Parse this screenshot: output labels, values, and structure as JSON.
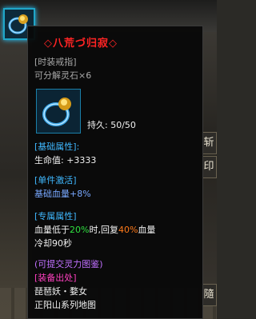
{
  "tooltip": {
    "title": "◇八荒づ归寂◇",
    "type_line": "[时装戒指]",
    "decompose_line": "可分解灵石×6",
    "durability_label": "持久: 50/50",
    "base_attr_header": "[基础属性]:",
    "base_attr_value": "生命值: +3333",
    "activation_header": "[单件激活]",
    "activation_value": "基础血量+8%",
    "special_header": "[专属属性]",
    "special_line1_a": "血量低于",
    "special_line1_b": "20%",
    "special_line1_c": "时,回复",
    "special_line1_d": "40%",
    "special_line1_e": "血量",
    "special_line2": "冷却90秒",
    "soul_line": "(可提交灵力图鉴)",
    "source_header": "[装备出处]",
    "source_line1": "琵琶妖・婺女",
    "source_line2": "正阳山系列地图"
  },
  "side_buttons": {
    "btn1": "斩",
    "btn2": "印",
    "btn3": "隨"
  },
  "colors": {
    "title": "#ff2424",
    "cyan": "#3fb8ff",
    "green": "#2fe040",
    "orange": "#ff7a1a",
    "violet": "#c070ff",
    "pink": "#ff40c0"
  },
  "icons": {
    "item": "ring-icon"
  }
}
